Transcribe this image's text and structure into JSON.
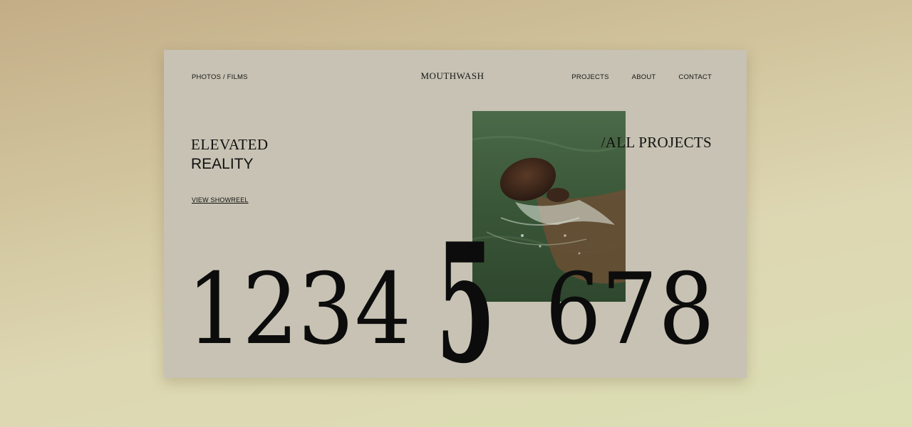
{
  "nav": {
    "left_link": "PHOTOS / FILMS",
    "logo": "MOUTHWASH",
    "items": [
      "PROJECTS",
      "ABOUT",
      "CONTACT"
    ]
  },
  "hero": {
    "line1": "ELEVATED",
    "line2": "REALITY",
    "cta": "VIEW SHOWREEL",
    "all_projects": "/ALL PROJECTS"
  },
  "project_numbers": [
    "1",
    "2",
    "3",
    "4",
    "5",
    "6",
    "7",
    "8"
  ],
  "active_number": "5",
  "colors": {
    "background": "#cfc19a",
    "card": "#c7c2b3",
    "text": "#111111",
    "photo_water": "#3f5d3f"
  }
}
